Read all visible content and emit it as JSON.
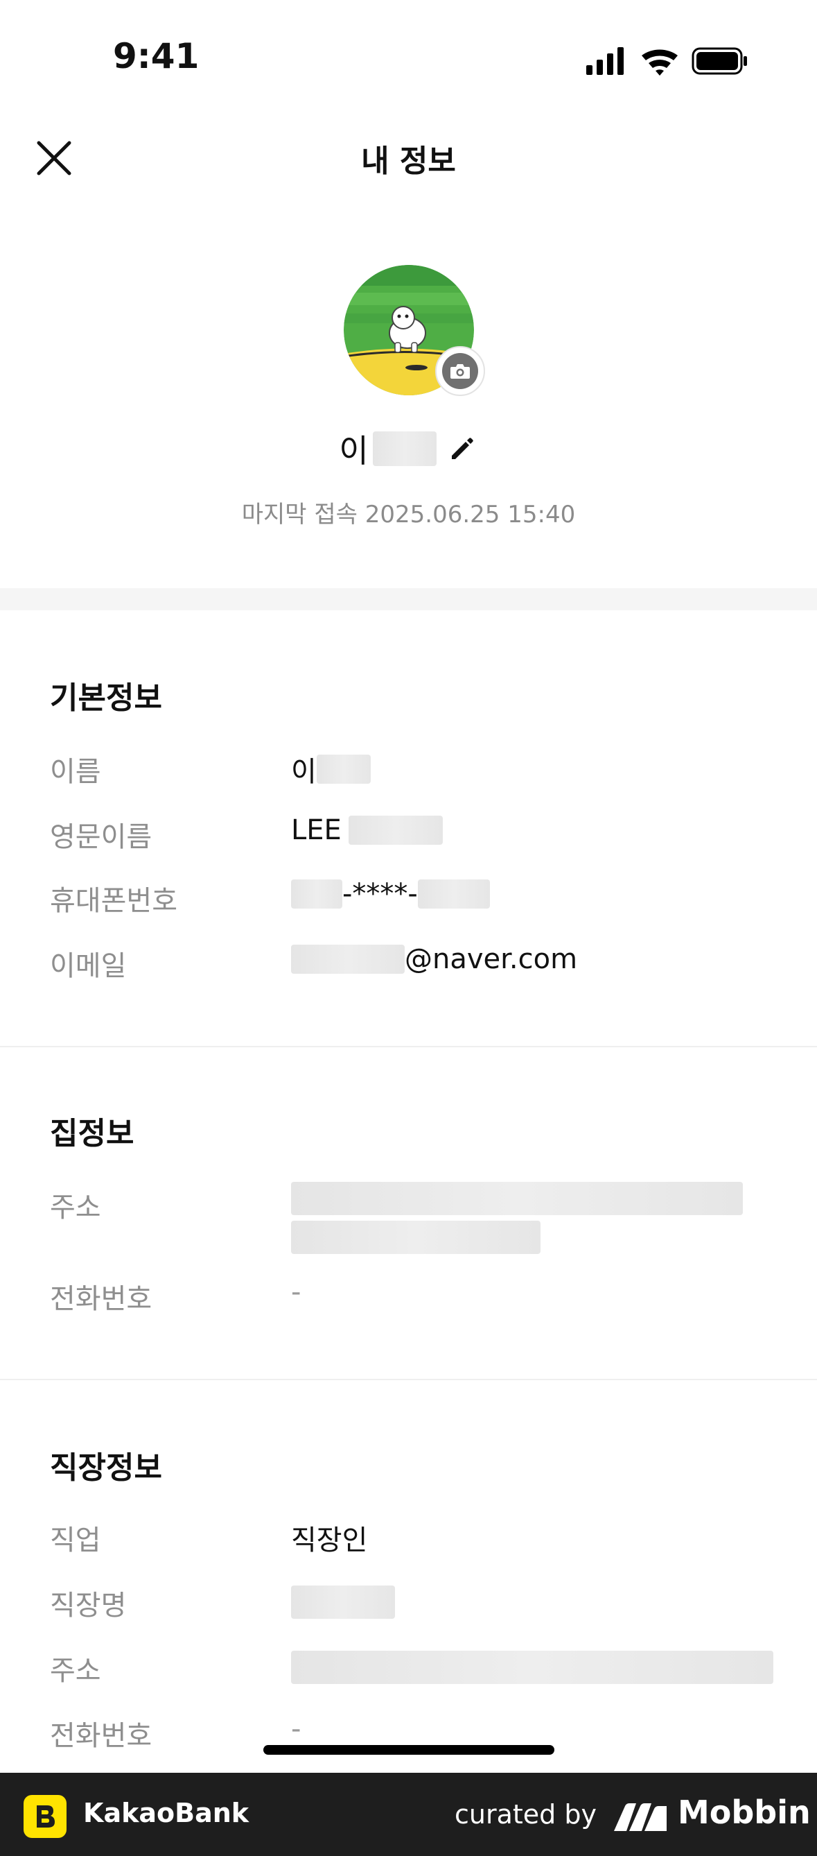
{
  "status_bar": {
    "time": "9:41"
  },
  "header": {
    "title": "내 정보"
  },
  "profile": {
    "name_prefix": "이",
    "last_login": "마지막 접속 2025.06.25 15:40"
  },
  "basic_info": {
    "title": "기본정보",
    "name_label": "이름",
    "name_prefix": "이",
    "english_name_label": "영문이름",
    "english_name_prefix": "LEE",
    "phone_label": "휴대폰번호",
    "phone_middle": "-****-",
    "email_label": "이메일",
    "email_suffix": "@naver.com"
  },
  "home_info": {
    "title": "집정보",
    "address_label": "주소",
    "phone_label": "전화번호",
    "phone_value": "-"
  },
  "work_info": {
    "title": "직장정보",
    "job_label": "직업",
    "job_value": "직장인",
    "company_label": "직장명",
    "address_label": "주소",
    "phone_label": "전화번호",
    "phone_value": "-"
  },
  "footer": {
    "app_name": "KakaoBank",
    "curated_by": "curated by",
    "brand": "Mobbin"
  },
  "colors": {
    "kakao_yellow": "#FFE300",
    "footer_bg": "#1e1e1e",
    "label_gray": "#8e8e8e"
  }
}
